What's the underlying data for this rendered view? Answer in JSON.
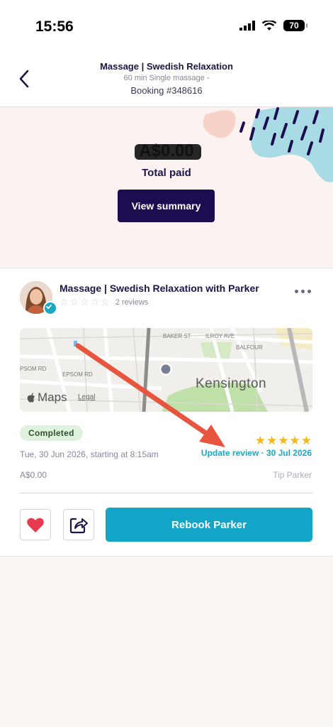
{
  "status_bar": {
    "time": "15:56",
    "battery": "70"
  },
  "nav": {
    "title": "Massage | Swedish Relaxation",
    "subtitle": "60 min Single massage -",
    "booking": "Booking #348616"
  },
  "summary": {
    "price": "A$0.00",
    "total_label": "Total paid",
    "view_summary_label": "View summary"
  },
  "card": {
    "title": "Massage  |  Swedish Relaxation with Parker",
    "reviews": "2 reviews",
    "map": {
      "area_label": "Kensington",
      "maps_label": "Maps",
      "legal_label": "Legal"
    },
    "status": "Completed",
    "date": "Tue, 30 Jun 2026, starting at 8:15am",
    "rating": 5,
    "update_review": "Update review · 30 Jul 2026",
    "amount": "A$0.00",
    "tip": "Tip Parker",
    "rebook_label": "Rebook Parker"
  },
  "colors": {
    "accent": "#12a5c8",
    "primary": "#1b0d4f",
    "star": "#f3b81a",
    "annotation_arrow": "#e8553e"
  }
}
